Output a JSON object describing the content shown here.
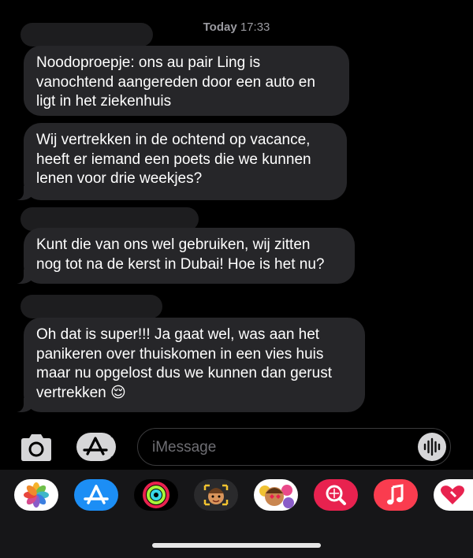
{
  "header": {
    "day": "Today",
    "time": "17:33"
  },
  "messages": [
    {
      "lines": [
        "Noodoproepje: ons au pair Ling is",
        "vanochtend aangereden door een auto en",
        "ligt in het ziekenhuis"
      ]
    },
    {
      "lines": [
        "Wij vertrekken in de ochtend op vacance,",
        "heeft er iemand een poets die we kunnen",
        "lenen voor drie weekjes?"
      ]
    },
    {
      "lines": [
        "Kunt die van ons wel gebruiken, wij zitten",
        "nog tot na de kerst in Dubai! Hoe is het nu?"
      ]
    },
    {
      "lines": [
        "Oh dat is super!!! Ja gaat wel, was aan het",
        "panikeren over thuiskomen in een vies huis",
        "maar nu opgelost dus we kunnen dan gerust",
        "vertrekken"
      ],
      "emoji": "😌"
    }
  ],
  "input": {
    "placeholder": "iMessage"
  },
  "icons": {
    "camera": "camera-icon",
    "app_store": "app-store-icon",
    "audio": "waveform-icon",
    "drawer": [
      "photos-app-icon",
      "app-store-app-icon",
      "activity-app-icon",
      "memoji-app-icon",
      "animoji-app-icon",
      "image-search-app-icon",
      "music-app-icon",
      "heart-app-icon"
    ]
  },
  "colors": {
    "background": "#000000",
    "bubble": "#262629",
    "sender_redacted": "#1d1d1f",
    "drawer": "#161618"
  }
}
